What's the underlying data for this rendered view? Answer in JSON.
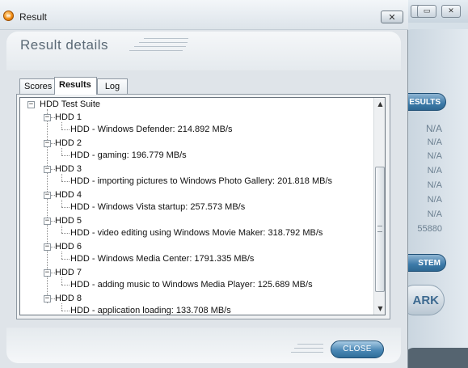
{
  "dialog": {
    "title": "Result",
    "close_glyph": "✕",
    "heading": "Result details",
    "tabs": [
      {
        "label": "Scores",
        "active": false
      },
      {
        "label": "Results",
        "active": true
      },
      {
        "label": "Log",
        "active": false
      }
    ],
    "tree": {
      "root": "HDD Test Suite",
      "groups": [
        {
          "label": "HDD 1",
          "item": "HDD - Windows Defender: 214.892 MB/s"
        },
        {
          "label": "HDD 2",
          "item": "HDD - gaming: 196.779 MB/s"
        },
        {
          "label": "HDD 3",
          "item": "HDD - importing pictures to Windows Photo Gallery: 201.818 MB/s"
        },
        {
          "label": "HDD 4",
          "item": "HDD - Windows Vista startup: 257.573 MB/s"
        },
        {
          "label": "HDD 5",
          "item": "HDD - video editing using Windows Movie Maker: 318.792 MB/s"
        },
        {
          "label": "HDD 6",
          "item": "HDD - Windows Media Center: 1791.335 MB/s"
        },
        {
          "label": "HDD 7",
          "item": "HDD - adding music to Windows Media Player: 125.689 MB/s"
        },
        {
          "label": "HDD 8",
          "item": "HDD - application loading: 133.708 MB/s"
        }
      ]
    },
    "close_button": "CLOSE"
  },
  "background_app": {
    "window_buttons": [
      "⎯",
      "▭",
      "✕"
    ],
    "results_button": "ESULTS",
    "values": [
      "N/A",
      "N/A",
      "N/A",
      "N/A",
      "N/A",
      "N/A",
      "N/A",
      "55880"
    ],
    "system_button": "STEM",
    "bench_button": "ARK"
  },
  "icons": {
    "app_icon": "futuremark-icon",
    "expander_collapse": "minus-expander-icon",
    "scroll_up": "scroll-up-arrow-icon",
    "scroll_down": "scroll-down-arrow-icon"
  }
}
